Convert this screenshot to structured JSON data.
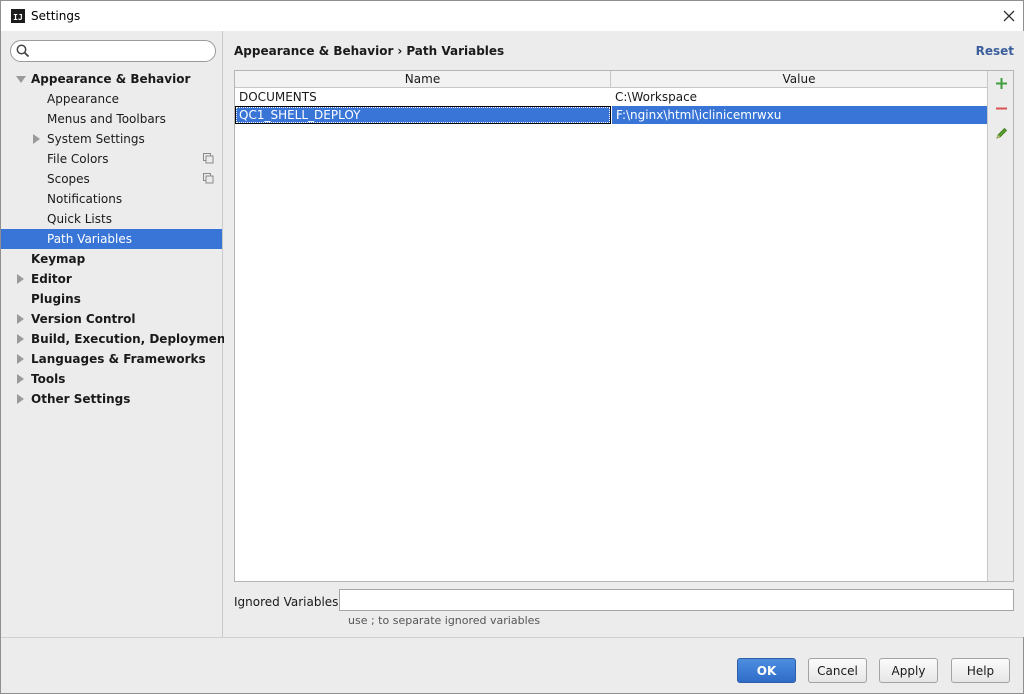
{
  "window": {
    "title": "Settings",
    "app_icon": "IJ"
  },
  "search": {
    "placeholder": "",
    "value": ""
  },
  "sidebar": {
    "items": [
      {
        "label": "Appearance & Behavior",
        "bold": true,
        "expand": "down"
      },
      {
        "label": "Appearance"
      },
      {
        "label": "Menus and Toolbars"
      },
      {
        "label": "System Settings",
        "expand": "right"
      },
      {
        "label": "File Colors",
        "copy_icon": true
      },
      {
        "label": "Scopes",
        "copy_icon": true
      },
      {
        "label": "Notifications"
      },
      {
        "label": "Quick Lists"
      },
      {
        "label": "Path Variables",
        "selected": true
      },
      {
        "label": "Keymap",
        "bold": true
      },
      {
        "label": "Editor",
        "bold": true,
        "expand": "right"
      },
      {
        "label": "Plugins",
        "bold": true
      },
      {
        "label": "Version Control",
        "bold": true,
        "expand": "right"
      },
      {
        "label": "Build, Execution, Deployment",
        "bold": true,
        "expand": "right"
      },
      {
        "label": "Languages & Frameworks",
        "bold": true,
        "expand": "right"
      },
      {
        "label": "Tools",
        "bold": true,
        "expand": "right"
      },
      {
        "label": "Other Settings",
        "bold": true,
        "expand": "right"
      }
    ]
  },
  "content": {
    "breadcrumb": {
      "parent": "Appearance & Behavior",
      "separator": "›",
      "current": "Path Variables"
    },
    "reset_label": "Reset",
    "table": {
      "columns": [
        "Name",
        "Value"
      ],
      "rows": [
        {
          "name": "DOCUMENTS",
          "value": "C:\\Workspace",
          "selected": false
        },
        {
          "name": "QC1_SHELL_DEPLOY",
          "value": "F:\\nginx\\html\\iclinicemrwxu",
          "selected": true
        }
      ]
    },
    "toolbar": {
      "add_icon": "plus-icon",
      "remove_icon": "minus-icon",
      "edit_icon": "pencil-icon"
    },
    "ignored": {
      "label": "Ignored Variables:",
      "value": "",
      "hint": "use ; to separate ignored variables"
    }
  },
  "footer": {
    "ok_label": "OK",
    "cancel_label": "Cancel",
    "apply_label": "Apply",
    "help_label": "Help"
  },
  "colors": {
    "selection": "#3875d7",
    "add": "#3f9e3f",
    "remove": "#d9534f",
    "edit": "#5aa02c",
    "link": "#3c5f9c"
  }
}
